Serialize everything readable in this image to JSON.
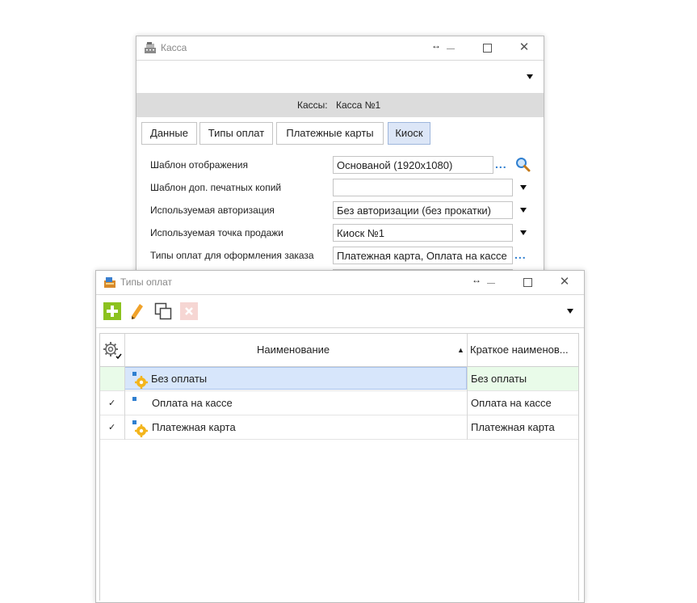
{
  "kassa_window": {
    "title": "Касса",
    "kassy_label": "Кассы:",
    "kassy_value": "Касса №1",
    "tabs": [
      {
        "label": "Данные",
        "active": false
      },
      {
        "label": "Типы оплат",
        "active": false
      },
      {
        "label": "Платежные карты",
        "active": false
      },
      {
        "label": "Киоск",
        "active": true
      }
    ],
    "fields": [
      {
        "label": "Шаблон отображения",
        "value": "Основаной (1920x1080)"
      },
      {
        "label": "Шаблон доп. печатных копий",
        "value": ""
      },
      {
        "label": "Используемая авторизация",
        "value": "Без авторизации (без прокатки)"
      },
      {
        "label": "Используемая точка продажи",
        "value": "Киоск №1"
      },
      {
        "label": "Типы оплат для оформления заказа",
        "value": "Платежная карта, Оплата на кассе"
      }
    ],
    "ellipsis": "..."
  },
  "payment_types_window": {
    "title": "Типы оплат",
    "toolbar": {
      "icons": [
        "add-icon",
        "edit-pencil-icon",
        "copy-icon",
        "delete-icon"
      ]
    },
    "grid": {
      "columns": [
        "Наименование",
        "Краткое наименов..."
      ],
      "sort_indicator": "▲",
      "rows": [
        {
          "checked": false,
          "name": "Без оплаты",
          "short_name": "Без оплаты",
          "selected": true,
          "icon": "gear-badge-icon"
        },
        {
          "checked": true,
          "name": "Оплата на кассе",
          "short_name": "Оплата на кассе",
          "selected": false,
          "icon": "square-icon"
        },
        {
          "checked": true,
          "name": "Платежная карта",
          "short_name": "Платежная карта",
          "selected": false,
          "icon": "gear-badge-icon"
        }
      ]
    }
  },
  "check_mark": "✓",
  "colors": {
    "selected_row": "#d7e6fb",
    "selected_row_short": "#e9fbe9",
    "accent_blue": "#2f7fd0",
    "add_green": "#8cc21f",
    "gear_orange": "#f3b51c"
  }
}
